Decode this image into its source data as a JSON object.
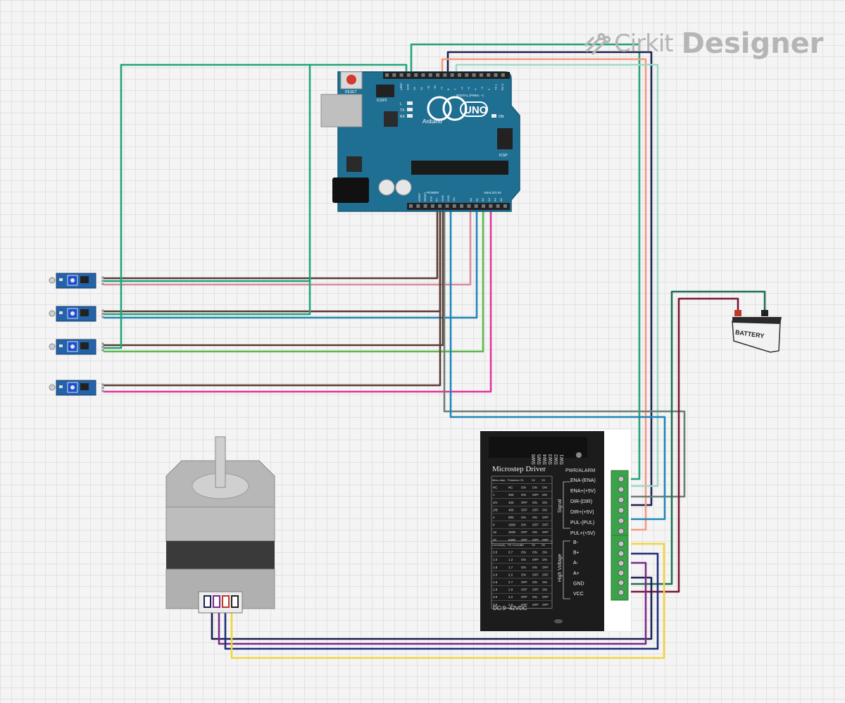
{
  "app": {
    "brand_word1": "Cirkit",
    "brand_word2": "Designer",
    "logo_icon": "cirkit-logo-icon"
  },
  "arduino": {
    "model": "UNO",
    "brand": "Arduino",
    "reset_label": "RESET",
    "icsp2_label": "ICSP2",
    "icsp_label": "ICSP",
    "led_l": "L",
    "led_tx": "TX",
    "led_rx": "RX",
    "on_label": "ON",
    "digital_label": "DIGITAL (PWM= ~)",
    "power_label": "POWER",
    "analog_label": "ANALOG IN",
    "digital_pins": [
      "AREF",
      "GND",
      "13",
      "12",
      "~11",
      "~10",
      "~9",
      "8",
      "7",
      "~6",
      "~5",
      "4",
      "~3",
      "2",
      "TX 1",
      "RX 0"
    ],
    "power_pins": [
      "IOREF",
      "RESET",
      "3V3",
      "5V",
      "GND",
      "GND",
      "Vin"
    ],
    "analog_pins": [
      "A0",
      "A1",
      "A2",
      "A3",
      "A4",
      "A5"
    ]
  },
  "battery": {
    "label": "BATTERY"
  },
  "driver": {
    "title": "Microstep Driver",
    "switch_labels": [
      "SW6",
      "SW5",
      "SW4",
      "SW3",
      "SW2",
      "SW1"
    ],
    "pwr_label": "PWR/ALARM",
    "signal_group": "Signal",
    "hv_group": "High Voltage",
    "terminals_signal": [
      "ENA-(ENA)",
      "ENA+(+5V)",
      "DIR-(DIR)",
      "DIR+(+5V)",
      "PUL-(PUL)",
      "PUL+(+5V)"
    ],
    "terminals_power": [
      "B-",
      "B+",
      "A-",
      "A+",
      "GND",
      "VCC"
    ],
    "footer": "DC:9~42VDC",
    "table1_header": [
      "Micro step",
      "Pulse/rev",
      "S1",
      "S2",
      "S3"
    ],
    "table1_rows": [
      [
        "NC",
        "NC",
        "ON",
        "ON",
        "ON"
      ],
      [
        "1",
        "200",
        "ON",
        "OFF",
        "ON"
      ],
      [
        "2/A",
        "400",
        "OFF",
        "ON",
        "ON"
      ],
      [
        "2/B",
        "400",
        "OFF",
        "OFF",
        "ON"
      ],
      [
        "4",
        "800",
        "ON",
        "ON",
        "OFF"
      ],
      [
        "8",
        "1600",
        "ON",
        "OFF",
        "OFF"
      ],
      [
        "16",
        "3200",
        "OFF",
        "ON",
        "OFF"
      ],
      [
        "32",
        "6400",
        "OFF",
        "OFF",
        "OFF"
      ]
    ],
    "table2_header": [
      "Current(A)",
      "PK Current",
      "S4",
      "S5",
      "S6"
    ],
    "table2_rows": [
      [
        "0.5",
        "0.7",
        "ON",
        "ON",
        "ON"
      ],
      [
        "1.0",
        "1.2",
        "ON",
        "OFF",
        "ON"
      ],
      [
        "1.5",
        "1.7",
        "ON",
        "ON",
        "OFF"
      ],
      [
        "2.0",
        "2.2",
        "ON",
        "OFF",
        "OFF"
      ],
      [
        "2.5",
        "2.7",
        "OFF",
        "ON",
        "ON"
      ],
      [
        "2.8",
        "2.9",
        "OFF",
        "OFF",
        "ON"
      ],
      [
        "3.0",
        "3.2",
        "OFF",
        "ON",
        "OFF"
      ],
      [
        "3.5",
        "4.0",
        "OFF",
        "OFF",
        "OFF"
      ]
    ]
  },
  "sensors": {
    "count": 4,
    "icon": "sensor-module-icon"
  },
  "motor": {
    "icon": "stepper-motor-icon"
  },
  "colors": {
    "board": "#1f6f93",
    "board_edge": "#155a78",
    "driver_body": "#1c1c1c",
    "terminal_green": "#3aa34a",
    "wire_teal": "#21a37a",
    "wire_navy": "#1b1f4e",
    "wire_salmon": "#f39a7f",
    "wire_mint": "#9fd9c7",
    "wire_brown": "#5a3a34",
    "wire_pink": "#d98ca0",
    "wire_blue": "#1f86b8",
    "wire_green": "#5db84a",
    "wire_magenta": "#e0359a",
    "wire_gray": "#6b7f75",
    "wire_darkred": "#7a1830",
    "wire_darkgreen": "#1f6e55",
    "wire_yellow": "#f2d43a",
    "wire_purple": "#7a2a8c",
    "wire_darkblue": "#1d2f7a"
  }
}
